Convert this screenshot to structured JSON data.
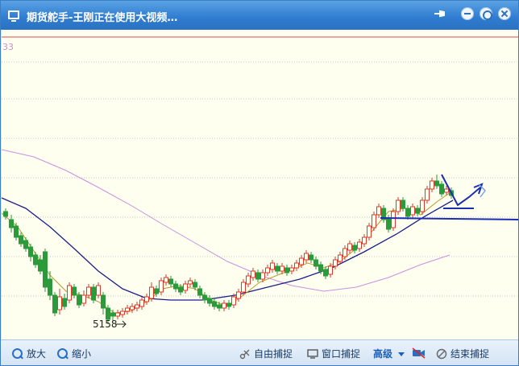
{
  "window": {
    "title": "期货舵手-王刚正在使用大视频…",
    "corner_label": "33"
  },
  "chart": {
    "price_annotation": "5158",
    "colors": {
      "up": "#d93a2c",
      "down": "#2a9a3a",
      "ma_short": "#b89a2a",
      "ma_mid": "#1a1f8c",
      "ma_long": "#c98fe0",
      "drawing": "#1a2fb0",
      "top_line": "#d94a4a",
      "grid": "#c9c9c9"
    }
  },
  "toolbar": {
    "zoom_in": "放大",
    "zoom_out": "缩小",
    "free_capture": "自由捕捉",
    "window_capture": "窗口捕捉",
    "advanced": "高级",
    "end_capture": "结束捕捉"
  },
  "icons": {
    "window": "monitor-icon",
    "pin": "pin-icon",
    "minimize": "minimize-icon",
    "restore": "restore-icon",
    "close": "close-icon",
    "zoom_in": "magnifier-icon",
    "zoom_out": "magnifier-icon",
    "free_capture": "scissors-icon",
    "window_capture": "monitor-icon",
    "advanced": "chevron-down-icon",
    "camera": "video-camera-icon",
    "end_capture": "stop-icon"
  }
}
